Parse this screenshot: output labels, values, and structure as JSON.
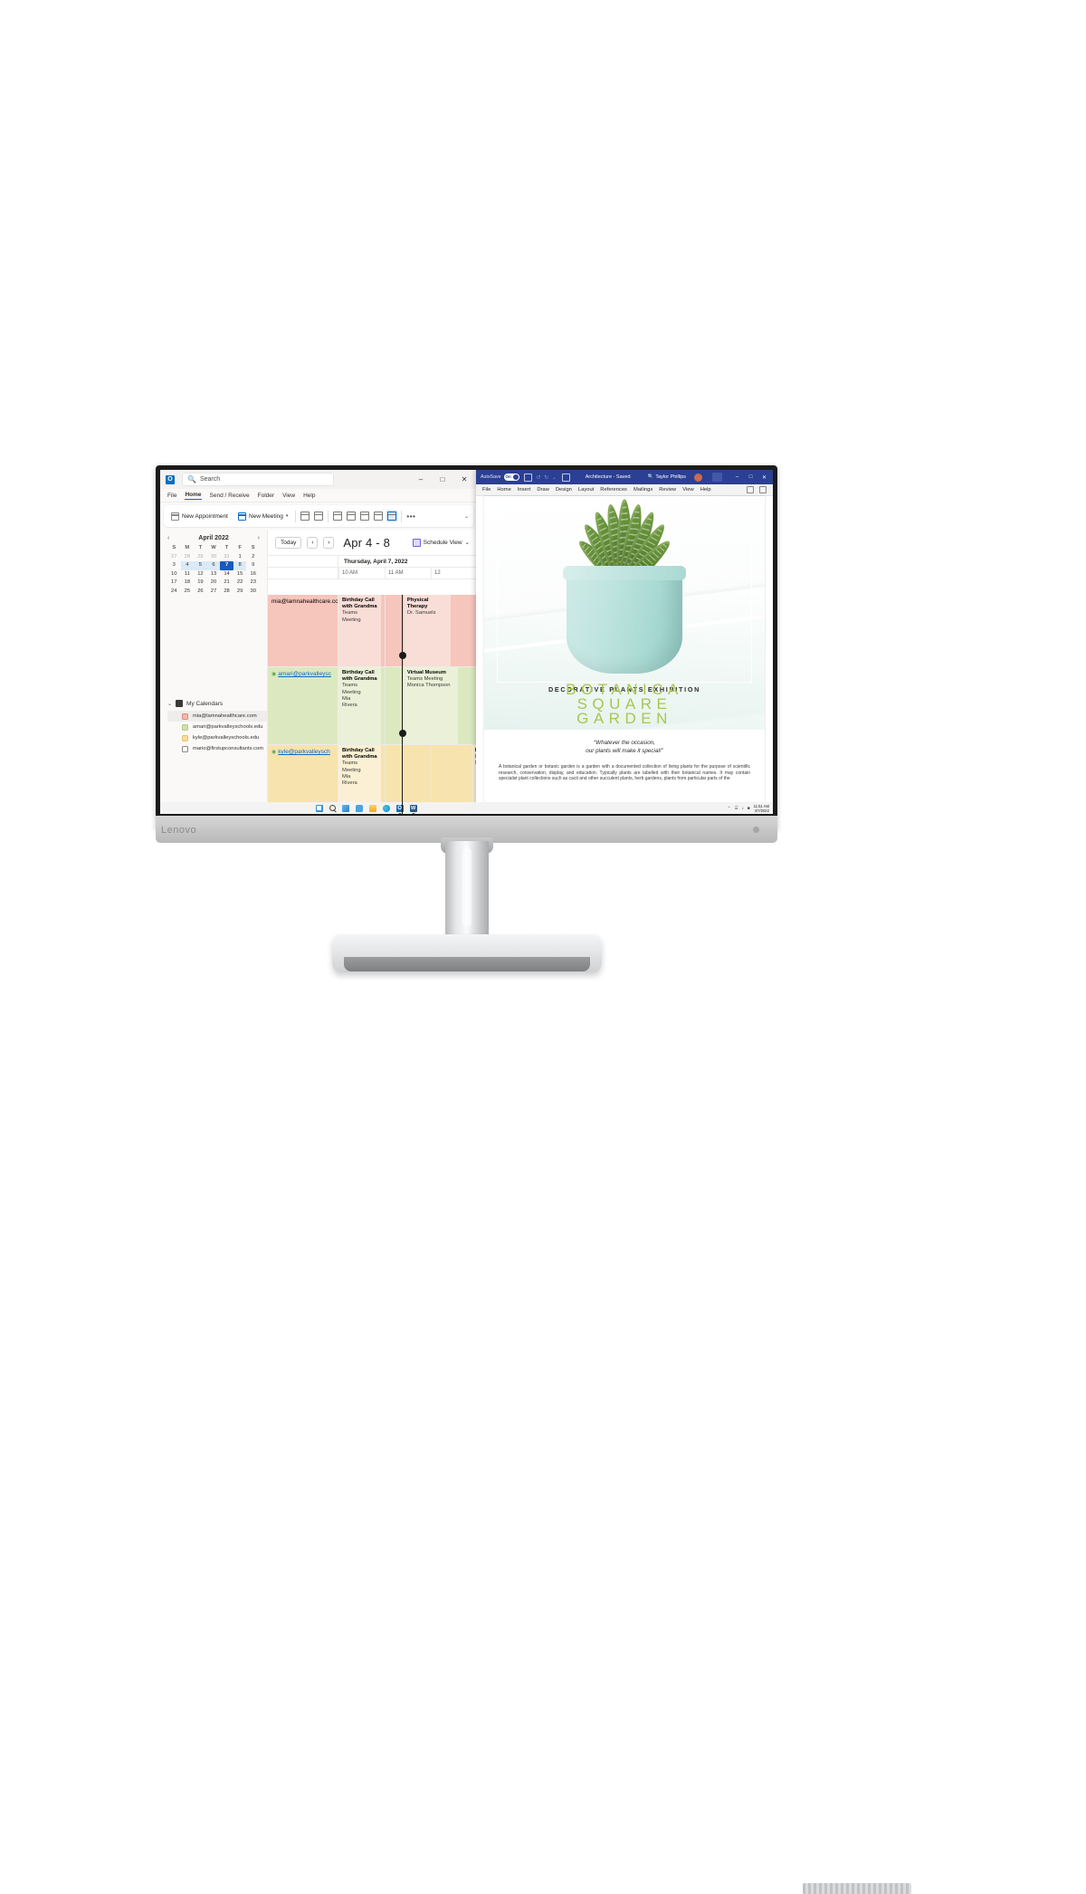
{
  "product": {
    "brand_logo": "Lenovo"
  },
  "outlook": {
    "app_icon": "outlook-icon",
    "search": {
      "placeholder": "Search",
      "icon": "search-icon"
    },
    "window_controls": {
      "minimize": "–",
      "maximize": "□",
      "close": "✕"
    },
    "menubar": [
      "File",
      "Home",
      "Send / Receive",
      "Folder",
      "View",
      "Help"
    ],
    "active_menu": "Home",
    "ribbon": {
      "new_appointment": "New Appointment",
      "new_meeting": "New Meeting",
      "new_meeting_caret": "▾",
      "overflow": "•••",
      "collapse": "⌄"
    },
    "minicalendar": {
      "prev": "‹",
      "next": "›",
      "title": "April 2022",
      "dow": [
        "S",
        "M",
        "T",
        "W",
        "T",
        "F",
        "S"
      ],
      "weeks": [
        [
          "27",
          "28",
          "29",
          "30",
          "31",
          "1",
          "2"
        ],
        [
          "3",
          "4",
          "5",
          "6",
          "7",
          "8",
          "9"
        ],
        [
          "10",
          "11",
          "12",
          "13",
          "14",
          "15",
          "16"
        ],
        [
          "17",
          "18",
          "19",
          "20",
          "21",
          "22",
          "23"
        ],
        [
          "24",
          "25",
          "26",
          "27",
          "28",
          "29",
          "30"
        ]
      ],
      "muted_first_row": [
        true,
        true,
        true,
        true,
        true,
        false,
        false
      ],
      "selected_week_index": 1,
      "today": "7"
    },
    "my_calendars": {
      "chevron": "⌄",
      "label": "My Calendars",
      "items": [
        {
          "label": "mia@lamnahealthcare.com",
          "color": "#f2b9ae",
          "checked": true,
          "selected": true
        },
        {
          "label": "amari@parkvalleyschools.edu",
          "color": "#cfe0ab",
          "checked": true,
          "selected": false
        },
        {
          "label": "kyle@parkvalleyschools.edu",
          "color": "#f6dd9a",
          "checked": true,
          "selected": false
        },
        {
          "label": "mario@firstupconsultants.com",
          "color": "#ffffff",
          "checked": false,
          "selected": false
        }
      ]
    },
    "calendar": {
      "today_button": "Today",
      "prev": "‹",
      "next": "›",
      "range": "Apr 4 - 8",
      "view_button": "Schedule View",
      "view_caret": "⌄",
      "day_header": "Thursday, April 7, 2022",
      "hours": [
        "10 AM",
        "11 AM",
        "12"
      ],
      "rows": [
        {
          "owner": "mia@lamnahealthcare.com",
          "color": "pink",
          "events": [
            {
              "title": "Birthday Call with Grandma",
              "lines": [
                "Teams",
                "Meeting"
              ],
              "left_pct": 0,
              "width_pct": 31
            },
            {
              "title": "Physical Therapy",
              "lines": [
                "Dr. Samuels"
              ],
              "left_pct": 47,
              "width_pct": 34
            }
          ]
        },
        {
          "owner": "amari@parkvalleysc",
          "color": "green",
          "events": [
            {
              "title": "Birthday Call with Grandma",
              "lines": [
                "Teams",
                "Meeting",
                "Mia",
                "Rivera"
              ],
              "left_pct": 0,
              "width_pct": 31
            },
            {
              "title": "Virtual Museum",
              "lines": [
                "Teams Meeting",
                "Monica Thompson"
              ],
              "left_pct": 47,
              "width_pct": 39
            }
          ]
        },
        {
          "owner": "kyle@parkvalleysch",
          "color": "yellow",
          "events": [
            {
              "title": "Birthday Call with Grandma",
              "lines": [
                "Teams",
                "Meeting",
                "Mia",
                "Rivera"
              ],
              "left_pct": 0,
              "width_pct": 31
            },
            {
              "title": "H",
              "lines": [
                "P",
                "M"
              ],
              "left_pct": 96,
              "width_pct": 14
            }
          ]
        }
      ]
    }
  },
  "word": {
    "autosave_label": "AutoSave",
    "autosave_state": "On",
    "save_icon": "save-icon",
    "undo_redo": "↺ ↻ ⌄",
    "accessibility_icon": "accessibility-icon",
    "accessibility_caret": "▾",
    "document_title": "Architecture - Saved",
    "document_title_caret": "▾",
    "search_icon": "search-icon",
    "user_name": "Taylor Phillips",
    "avatar": "user-avatar",
    "ribbon_display_icon": "ribbon-display-icon",
    "window_controls": {
      "minimize": "–",
      "maximize": "□",
      "close": "✕"
    },
    "menubar": [
      "File",
      "Home",
      "Insert",
      "Draw",
      "Design",
      "Layout",
      "References",
      "Mailings",
      "Review",
      "View",
      "Help"
    ],
    "document": {
      "poster_category": "DECORATIVE PLANTS EXHIBITION",
      "poster_title_lines": [
        "BOTANICA",
        "SQUARE",
        "GARDEN"
      ],
      "poster_title_color": "#a6c84f",
      "quote_line1": "“Whatever the occasion,",
      "quote_line2": "our plants will make it special!”",
      "body": "A botanical garden or botanic garden is a garden with a documented collection of living plants for the purpose of scientific research, conservation, display, and education. Typically plants are labelled with their botanical names. It may contain specialist plant collections such as cacti and other succulent plants, herb gardens, plants from particular parts of the"
    }
  },
  "taskbar": {
    "icons": [
      "start-icon",
      "search-icon",
      "widgets-icon",
      "chat-icon",
      "file-explorer-icon",
      "edge-icon",
      "outlook-icon",
      "word-icon"
    ],
    "tray": {
      "chevron": "⌃",
      "wifi": "wifi-icon",
      "volume": "volume-icon",
      "battery": "battery-icon"
    },
    "clock_time": "11:51 AM",
    "clock_date": "4/7/2022"
  }
}
